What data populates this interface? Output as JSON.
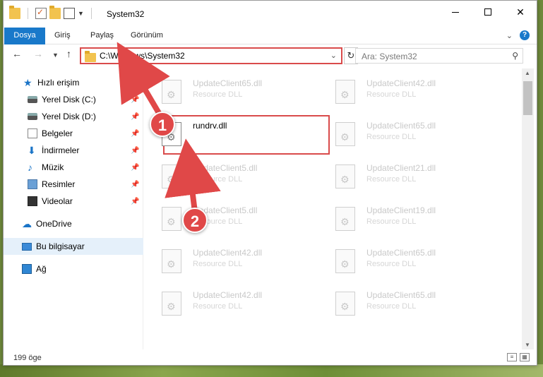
{
  "window": {
    "title": "System32",
    "minimize_glyph": "—",
    "close_glyph": "✕"
  },
  "ribbon": {
    "tabs": [
      "Dosya",
      "Giriş",
      "Paylaş",
      "Görünüm"
    ],
    "accent_color": "#1979ca"
  },
  "navigation": {
    "address": "C:\\Windows\\System32",
    "search_placeholder": "Ara: System32"
  },
  "sidebar": {
    "items": [
      {
        "label": "Hızlı erişim",
        "icon": "star-icon"
      },
      {
        "label": "Yerel Disk (C:)",
        "icon": "drive-icon",
        "pinned": true
      },
      {
        "label": "Yerel Disk (D:)",
        "icon": "drive-icon",
        "pinned": true
      },
      {
        "label": "Belgeler",
        "icon": "document-icon",
        "pinned": true
      },
      {
        "label": "İndirmeler",
        "icon": "download-icon",
        "pinned": true
      },
      {
        "label": "Müzik",
        "icon": "music-icon",
        "pinned": true
      },
      {
        "label": "Resimler",
        "icon": "pictures-icon",
        "pinned": true
      },
      {
        "label": "Videolar",
        "icon": "video-icon",
        "pinned": true
      },
      {
        "label": "OneDrive",
        "icon": "cloud-icon"
      },
      {
        "label": "Bu bilgisayar",
        "icon": "computer-icon",
        "selected": true
      },
      {
        "label": "Ağ",
        "icon": "network-icon"
      }
    ]
  },
  "files": [
    {
      "name": "UpdateClient65.dll",
      "type": "Resource DLL"
    },
    {
      "name": "UpdateClient42.dll",
      "type": "Resource DLL"
    },
    {
      "name": "rundrv.dll",
      "type": "",
      "highlighted": true
    },
    {
      "name": "UpdateClient65.dll",
      "type": "Resource DLL"
    },
    {
      "name": "UpdateClient5.dll",
      "type": "Resource DLL"
    },
    {
      "name": "UpdateClient21.dll",
      "type": "Resource DLL"
    },
    {
      "name": "UpdateClient5.dll",
      "type": "Resource DLL"
    },
    {
      "name": "UpdateClient19.dll",
      "type": "Resource DLL"
    },
    {
      "name": "UpdateClient42.dll",
      "type": "Resource DLL"
    },
    {
      "name": "UpdateClient65.dll",
      "type": "Resource DLL"
    },
    {
      "name": "UpdateClient42.dll",
      "type": "Resource DLL"
    },
    {
      "name": "UpdateClient65.dll",
      "type": "Resource DLL"
    }
  ],
  "status": {
    "item_count": "199 öge"
  },
  "annotations": {
    "step1": "1",
    "step2": "2",
    "color": "#e04848"
  }
}
